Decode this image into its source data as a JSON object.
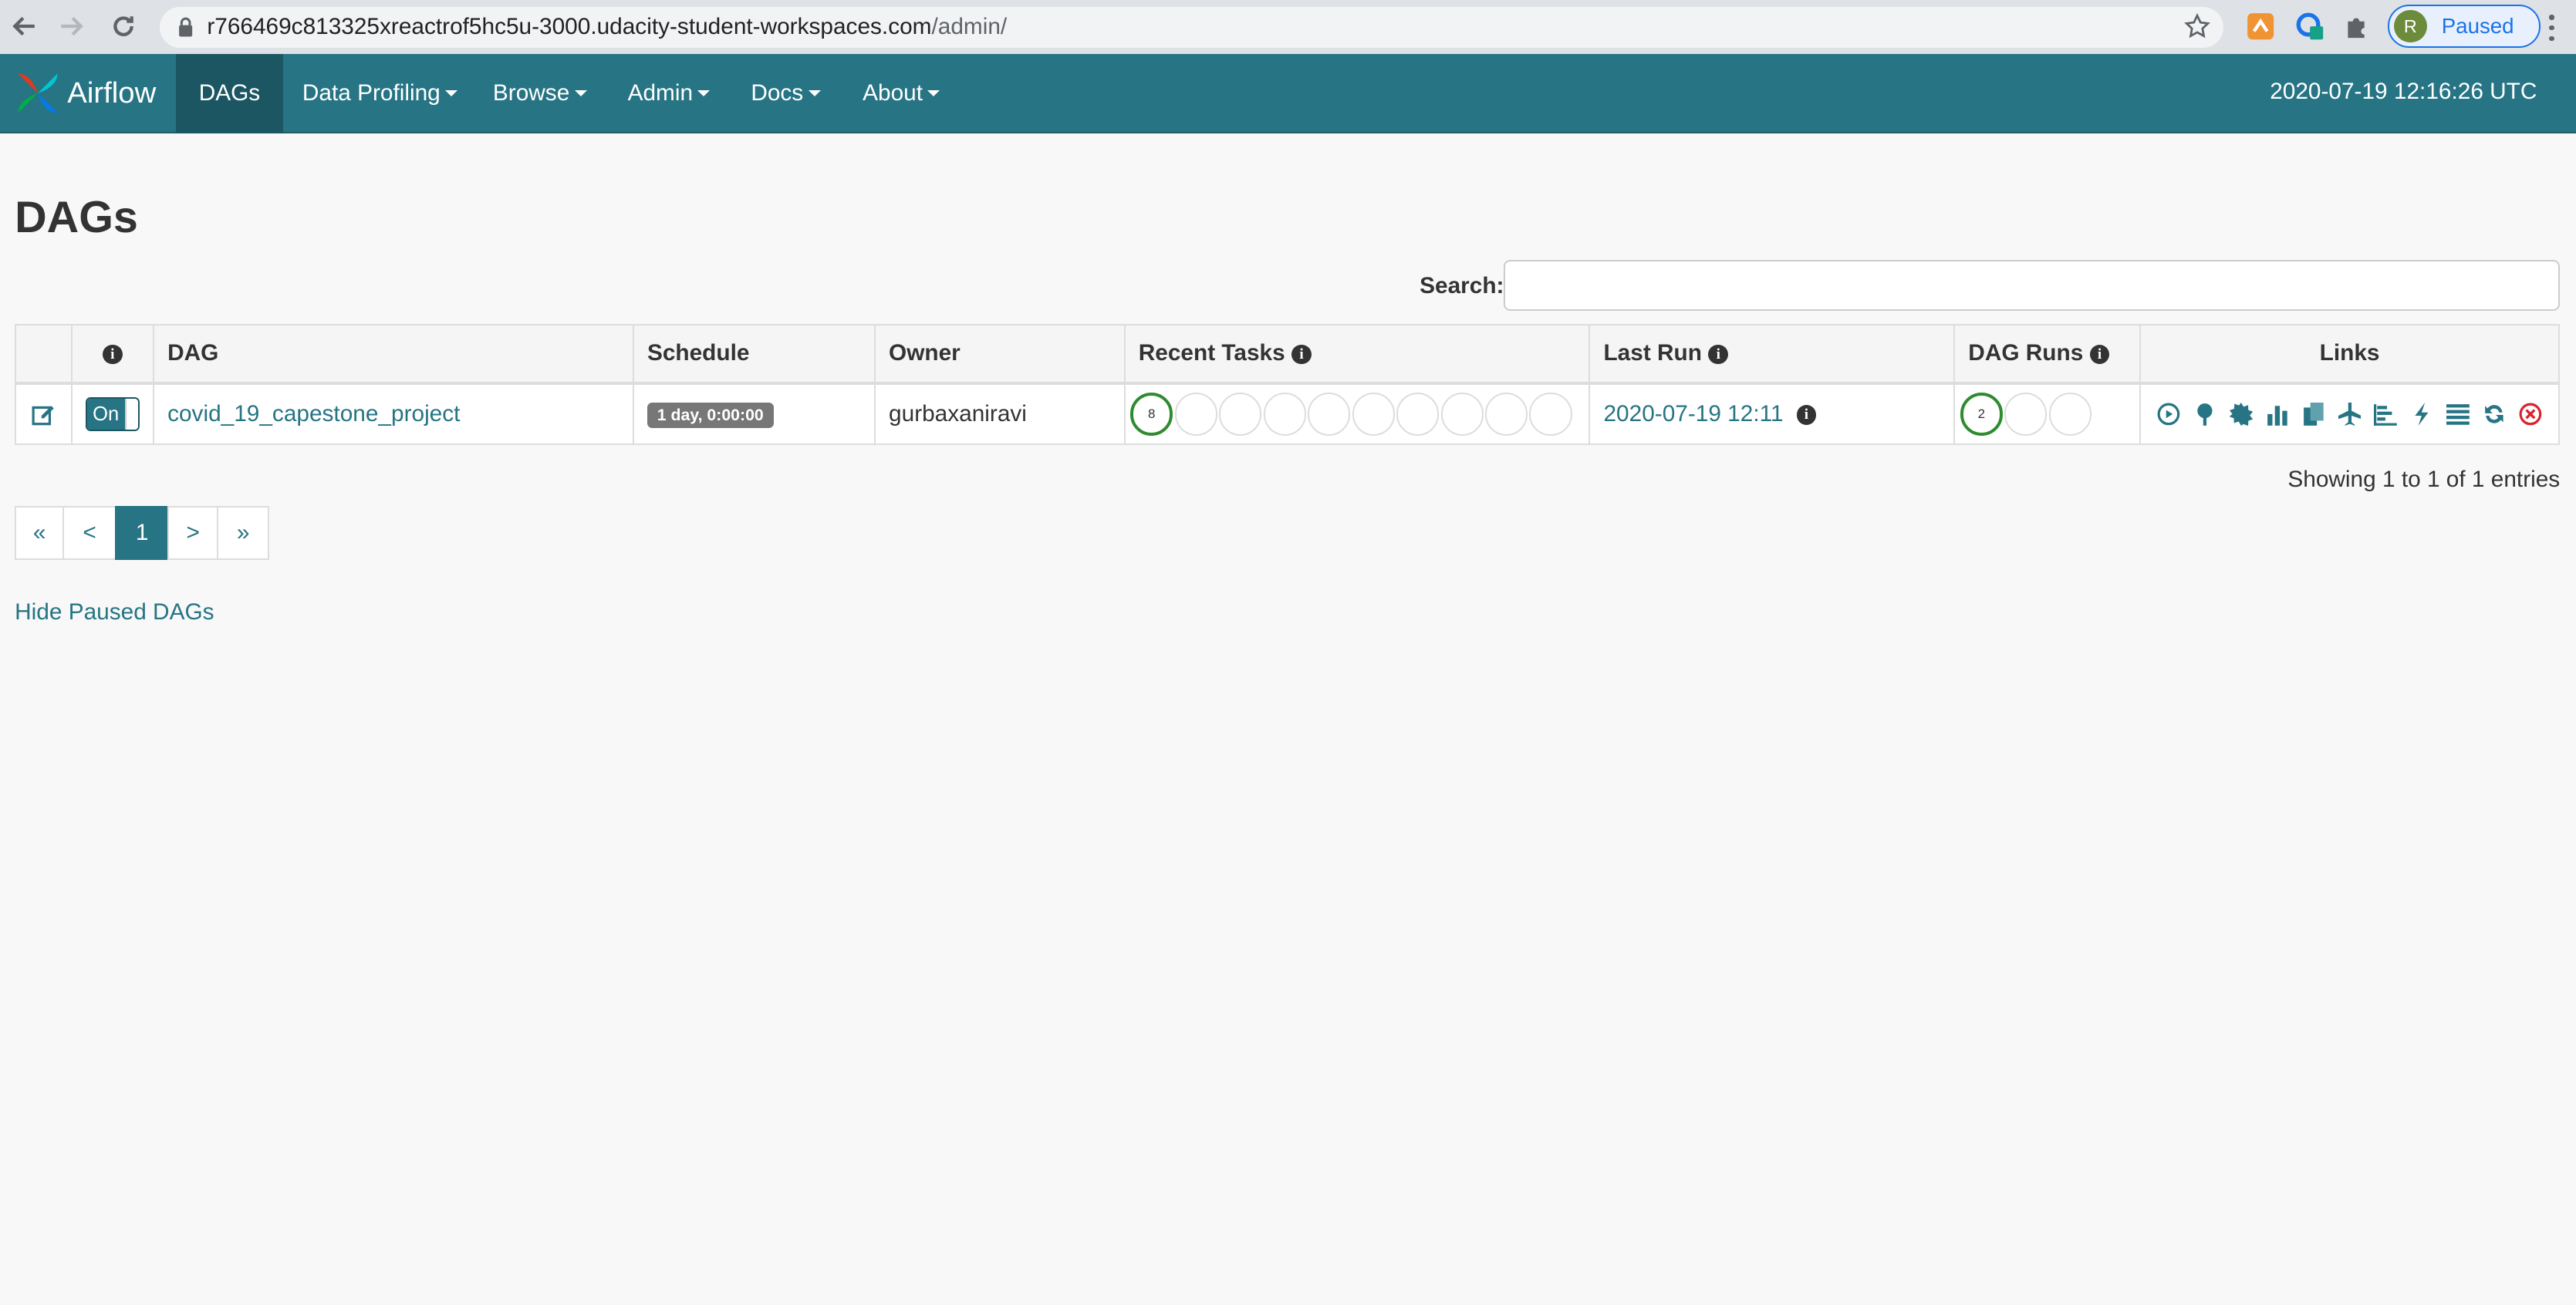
{
  "browser": {
    "url_host": "r766469c813325xreactrof5hc5u-3000.udacity-student-workspaces.com",
    "url_path": "/admin/",
    "profile_initial": "R",
    "profile_status": "Paused"
  },
  "navbar": {
    "brand": "Airflow",
    "items": [
      {
        "label": "DAGs"
      },
      {
        "label": "Data Profiling"
      },
      {
        "label": "Browse"
      },
      {
        "label": "Admin"
      },
      {
        "label": "Docs"
      },
      {
        "label": "About"
      }
    ],
    "clock": "2020-07-19 12:16:26 UTC",
    "accent": "#267484"
  },
  "page": {
    "title": "DAGs",
    "search_label": "Search:",
    "search_value": ""
  },
  "table": {
    "headers": {
      "dag": "DAG",
      "schedule": "Schedule",
      "owner": "Owner",
      "recent_tasks": "Recent Tasks",
      "last_run": "Last Run",
      "dag_runs": "DAG Runs",
      "links": "Links"
    },
    "rows": [
      {
        "toggle": "On",
        "dag_id": "covid_19_capestone_project",
        "schedule": "1 day, 0:00:00",
        "owner": "gurbaxaniravi",
        "recent_tasks_count": "8",
        "last_run": "2020-07-19 12:11",
        "dag_runs_count": "2"
      }
    ],
    "link_icons": [
      "trigger-dag-icon",
      "tree-view-icon",
      "graph-view-icon",
      "task-duration-icon",
      "task-tries-icon",
      "landing-times-icon",
      "gantt-icon",
      "code-icon",
      "logs-icon",
      "refresh-icon",
      "delete-icon"
    ]
  },
  "footer": {
    "showing": "Showing 1 to 1 of 1 entries",
    "pager": [
      "«",
      "<",
      "1",
      ">",
      "»"
    ],
    "hide_paused": "Hide Paused DAGs"
  }
}
